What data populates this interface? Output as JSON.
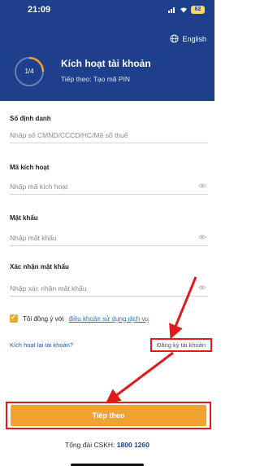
{
  "status_bar": {
    "time": "21:09",
    "battery": "62"
  },
  "header": {
    "language": "English",
    "step_label": "1/4",
    "title": "Kích hoạt tài khoản",
    "subtitle": "Tiếp theo: Tạo mã PIN"
  },
  "form": {
    "id_label": "Số định danh",
    "id_placeholder": "Nhập số CMND/CCCD/HC/Mã số thuế",
    "code_label": "Mã kích hoạt",
    "code_placeholder": "Nhập mã kích hoạt",
    "password_label": "Mật khẩu",
    "password_placeholder": "Nhập mật khẩu",
    "confirm_label": "Xác nhận mật khẩu",
    "confirm_placeholder": "Nhập xác nhận mật khẩu"
  },
  "agree": {
    "prefix": "Tôi đồng ý với",
    "link": "điều khoản sử dụng dịch vụ"
  },
  "links": {
    "reactivate": "Kích hoạt lại tài khoản?",
    "register": "Đăng ký tài khoản"
  },
  "next_button": "Tiếp theo",
  "hotline": {
    "label": "Tổng đài CSKH:",
    "number": "1800 1260"
  },
  "colors": {
    "header": "#1d3f8c",
    "accent": "#f0a332",
    "highlight": "#e01b1b",
    "link": "#2a52b5"
  }
}
